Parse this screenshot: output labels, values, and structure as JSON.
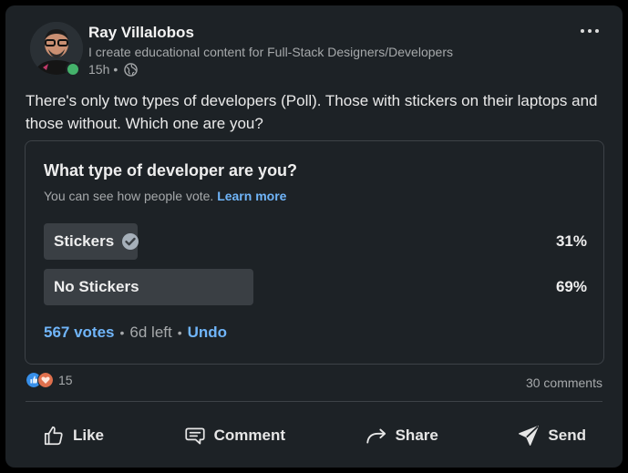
{
  "author": {
    "name": "Ray Villalobos",
    "headline": "I create educational content for Full-Stack Designers/Developers",
    "time": "15h",
    "dot": "•"
  },
  "post": {
    "text": "There's only two types of developers (Poll). Those with stickers on their laptops and those without. Which one are you?"
  },
  "poll": {
    "question": "What type of developer are you?",
    "subtitle": "You can see how people vote.",
    "learn_more": "Learn more",
    "options": [
      {
        "label": "Stickers",
        "percent_text": "31%",
        "percent": 31,
        "selected": true
      },
      {
        "label": "No Stickers",
        "percent_text": "69%",
        "percent": 69,
        "selected": false
      }
    ],
    "votes": "567 votes",
    "dot": "•",
    "time_left": "6d left",
    "undo": "Undo"
  },
  "social": {
    "reaction_count": "15",
    "comments": "30 comments"
  },
  "actions": {
    "like": "Like",
    "comment": "Comment",
    "share": "Share",
    "send": "Send"
  },
  "colors": {
    "card_bg": "#1d2226",
    "link": "#70b5f9",
    "bar": "#3a3f44",
    "online": "#44b26b"
  },
  "icons": [
    "more-icon",
    "globe-icon",
    "check-icon",
    "like-reaction-icon",
    "love-reaction-icon",
    "like-icon",
    "comment-icon",
    "share-icon",
    "send-icon"
  ]
}
